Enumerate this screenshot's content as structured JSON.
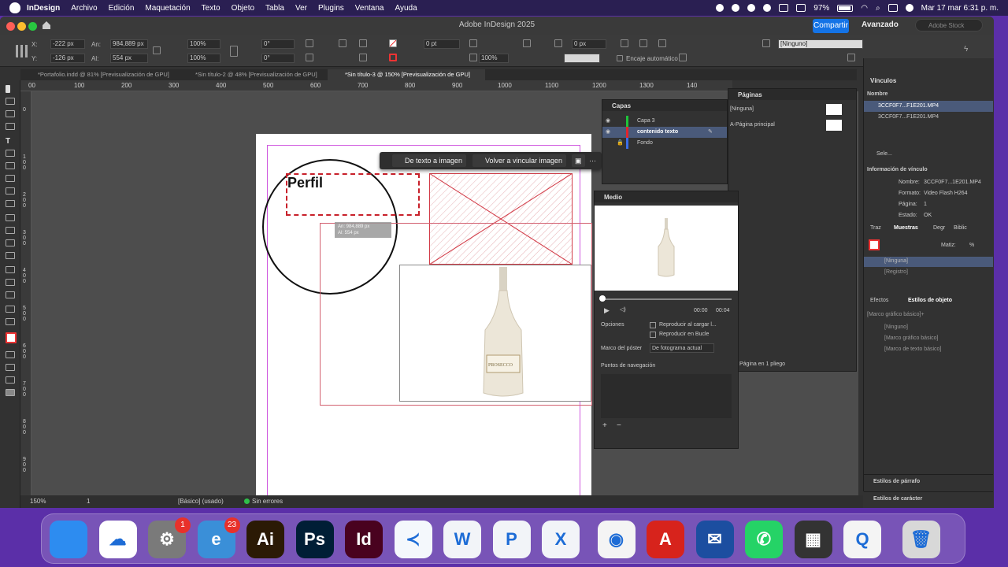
{
  "menubar": {
    "app": "InDesign",
    "items": [
      "Archivo",
      "Edición",
      "Maquetación",
      "Texto",
      "Objeto",
      "Tabla",
      "Ver",
      "Plugins",
      "Ventana",
      "Ayuda"
    ],
    "battery": "97%",
    "datetime": "Mar 17 mar 6:31 p. m."
  },
  "window": {
    "title": "Adobe InDesign 2025",
    "share_label": "Compartir",
    "workspace": "Avanzado",
    "search_placeholder": "Adobe Stock"
  },
  "control": {
    "x_label": "X:",
    "x_value": "-222 px",
    "y_label": "Y:",
    "y_value": "-126 px",
    "w_label": "An:",
    "w_value": "984,889 px",
    "h_label": "Al:",
    "h_value": "554 px",
    "scale_x": "100%",
    "scale_y": "100%",
    "rotate": "0°",
    "shear": "0°",
    "stroke_weight": "0 pt",
    "opacity": "100%",
    "offset": "0 px",
    "autofit_label": "Encaje automático",
    "object_style": "[Ninguno]"
  },
  "tabs": [
    {
      "label": "*Portafolio.indd @ 81% [Previsualización de GPU]",
      "active": false
    },
    {
      "label": "*Sin título-2 @ 48% [Previsualización de GPU]",
      "active": false
    },
    {
      "label": "*Sin título-3 @ 150% [Previsualización de GPU]",
      "active": true
    }
  ],
  "ruler": {
    "ticks": [
      "00",
      "100",
      "200",
      "300",
      "400",
      "500",
      "600",
      "700",
      "800",
      "900",
      "1000",
      "1100",
      "1200",
      "1300",
      "140"
    ],
    "vticks": [
      "0",
      "1 0 0",
      "2 0 0",
      "3 0 0",
      "4 0 0",
      "5 0 0",
      "6 0 0",
      "7 0 0",
      "8 0 0",
      "9 0 0"
    ]
  },
  "canvas": {
    "heading_text": "Perfil",
    "tooltip_line1": "An: 984,889 px",
    "tooltip_line2": "Al: 554 px",
    "bottle_label": "PROSECCO"
  },
  "context_bar": {
    "text_to_image": "De texto a imagen",
    "relink_image": "Volver a vincular imagen",
    "more": "···"
  },
  "layers_panel": {
    "title": "Capas",
    "layers": [
      {
        "name": "Capa 3",
        "color": "#1ec43a"
      },
      {
        "name": "contenido texto",
        "color": "#e3242b"
      },
      {
        "name": "Fondo",
        "color": "#3a6ee8"
      }
    ]
  },
  "pages_panel": {
    "title": "Páginas",
    "items": [
      "[Ninguna]",
      "A-Página principal"
    ],
    "footer": "Página en 1 pliego"
  },
  "media_panel": {
    "title": "Medio",
    "time_current": "00:00",
    "time_total": "00:04",
    "options_label": "Opciones",
    "option1": "Reproducir al cargar l...",
    "option2": "Reproducir en Bucle",
    "poster_label": "Marco del póster",
    "poster_value": "De fotograma actual",
    "nav_points": "Puntos de navegación"
  },
  "links_panel": {
    "title": "Vínculos",
    "column": "Nombre",
    "items": [
      "3CCF0F7...F1E201.MP4",
      "3CCF0F7...F1E201.MP4"
    ],
    "selected_label": "Sele...",
    "info_title": "Información de vínculo",
    "info": [
      {
        "k": "Nombre:",
        "v": "3CCF0F7...1E201.MP4"
      },
      {
        "k": "Formato:",
        "v": "Video Flash H264"
      },
      {
        "k": "Página:",
        "v": "1"
      },
      {
        "k": "Estado:",
        "v": "OK"
      }
    ]
  },
  "swatches_panel": {
    "tabs": [
      "Traz",
      "Muestras",
      "Degr",
      "Biblic"
    ],
    "tint_label": "Matiz:",
    "tint_unit": "%",
    "items": [
      "[Ninguna]",
      "[Registro]"
    ]
  },
  "object_styles_panel": {
    "tabs": [
      "Efectos",
      "Estilos de objeto"
    ],
    "header": "[Marco gráfico básico]+",
    "items": [
      "[Ninguno]",
      "[Marco gráfico básico]",
      "[Marco de texto básico]"
    ]
  },
  "collapsed_panels": [
    "Estilos de párrafo",
    "Estilos de carácter"
  ],
  "status": {
    "zoom": "150%",
    "page": "1",
    "style": "[Básico] (usado)",
    "errors": "Sin errores"
  },
  "dock": {
    "apps": [
      {
        "name": "Finder",
        "glyph": "",
        "color": "#2d8cf0"
      },
      {
        "name": "OneDrive",
        "glyph": "☁",
        "color": "#ffffff"
      },
      {
        "name": "Preferencias",
        "glyph": "⚙",
        "color": "#7a7a7a",
        "badge": "1"
      },
      {
        "name": "Mail",
        "glyph": "e",
        "color": "#3a8fd8",
        "badge": "23"
      },
      {
        "name": "Illustrator",
        "glyph": "Ai",
        "color": "#2b1a05"
      },
      {
        "name": "Photoshop",
        "glyph": "Ps",
        "color": "#001e36"
      },
      {
        "name": "InDesign",
        "glyph": "Id",
        "color": "#49021f"
      },
      {
        "name": "VS Code",
        "glyph": "≺",
        "color": "#f4f8fc"
      },
      {
        "name": "Word",
        "glyph": "W",
        "color": "#f2f4f8"
      },
      {
        "name": "PowerPoint",
        "glyph": "P",
        "color": "#f2f4f8"
      },
      {
        "name": "Excel",
        "glyph": "X",
        "color": "#f2f4f8"
      },
      {
        "name": "Chrome",
        "glyph": "◉",
        "color": "#f4f4f4"
      },
      {
        "name": "Acrobat",
        "glyph": "A",
        "color": "#d7231c"
      },
      {
        "name": "Thunderbird",
        "glyph": "✉",
        "color": "#1c4ea0"
      },
      {
        "name": "WhatsApp",
        "glyph": "✆",
        "color": "#25d366"
      },
      {
        "name": "Calculadora",
        "glyph": "▦",
        "color": "#333333"
      },
      {
        "name": "QuickTime",
        "glyph": "Q",
        "color": "#f4f4f4"
      },
      {
        "name": "Papelera",
        "glyph": "🗑",
        "color": "#d8d8d8"
      }
    ]
  }
}
